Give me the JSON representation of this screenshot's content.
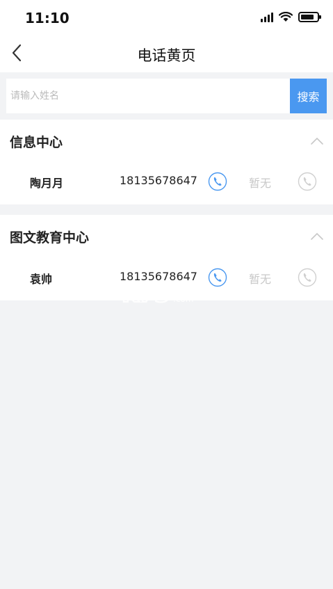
{
  "status_bar": {
    "time": "11:10"
  },
  "nav": {
    "title": "电话黄页"
  },
  "search": {
    "placeholder": "请输入姓名",
    "button_label": "搜索"
  },
  "sections": [
    {
      "title": "信息中心",
      "contacts": [
        {
          "name": "陶月月",
          "phone": "18135678647",
          "alt_phone": "暂无"
        }
      ]
    },
    {
      "title": "图文教育中心",
      "contacts": [
        {
          "name": "袁帅",
          "phone": "18135678647",
          "alt_phone": "暂无"
        }
      ]
    }
  ],
  "watermark": {
    "text": "游戏之家",
    "domain": ".com"
  },
  "colors": {
    "accent": "#4a98f0",
    "muted": "#c8c8c8",
    "background": "#f2f3f5"
  }
}
